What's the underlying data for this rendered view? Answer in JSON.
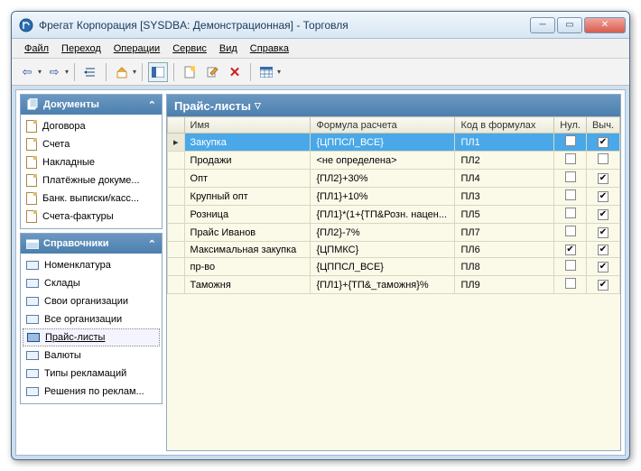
{
  "window": {
    "title": "Фрегат Корпорация [SYSDBA: Демонстрационная] - Торговля"
  },
  "menu": {
    "file": "Файл",
    "goto": "Переход",
    "ops": "Операции",
    "service": "Сервис",
    "view": "Вид",
    "help": "Справка"
  },
  "sidebar": {
    "docs_title": "Документы",
    "docs": [
      "Договора",
      "Счета",
      "Накладные",
      "Платёжные докуме...",
      "Банк. выписки/касс...",
      "Счета-фактуры"
    ],
    "refs_title": "Справочники",
    "refs": [
      "Номенклатура",
      "Склады",
      "Свои организации",
      "Все организации",
      "Прайс-листы",
      "Валюты",
      "Типы рекламаций",
      "Решения по реклам..."
    ],
    "refs_selected": 4
  },
  "content": {
    "title": "Прайс-листы",
    "columns": {
      "name": "Имя",
      "formula": "Формула расчета",
      "code": "Код в формулах",
      "nul": "Нул.",
      "calc": "Выч."
    },
    "rows": [
      {
        "name": "Закупка",
        "formula": "{ЦППСЛ_ВСЕ}",
        "code": "ПЛ1",
        "nul": false,
        "calc": true,
        "sel": true
      },
      {
        "name": "Продажи",
        "formula": "<не определена>",
        "code": "ПЛ2",
        "nul": false,
        "calc": false
      },
      {
        "name": "Опт",
        "formula": "{ПЛ2}+30%",
        "code": "ПЛ4",
        "nul": false,
        "calc": true
      },
      {
        "name": "Крупный опт",
        "formula": "{ПЛ1}+10%",
        "code": "ПЛ3",
        "nul": false,
        "calc": true
      },
      {
        "name": "Розница",
        "formula": "{ПЛ1}*(1+{ТП&Розн. нацен...",
        "code": "ПЛ5",
        "nul": false,
        "calc": true
      },
      {
        "name": "Прайс Иванов",
        "formula": "{ПЛ2}-7%",
        "code": "ПЛ7",
        "nul": false,
        "calc": true
      },
      {
        "name": "Максимальная закупка",
        "formula": "{ЦПМКС}",
        "code": "ПЛ6",
        "nul": true,
        "calc": true
      },
      {
        "name": "пр-во",
        "formula": "{ЦППСЛ_ВСЕ}",
        "code": "ПЛ8",
        "nul": false,
        "calc": true
      },
      {
        "name": "Таможня",
        "formula": "{ПЛ1}+{ТП&_таможня}%",
        "code": "ПЛ9",
        "nul": false,
        "calc": true
      }
    ]
  }
}
